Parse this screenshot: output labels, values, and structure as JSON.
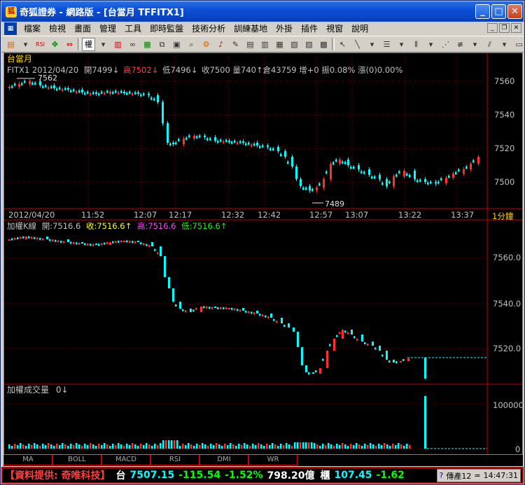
{
  "window": {
    "title": "奇狐證券 - 網路版 - [台當月 TFFITX1]"
  },
  "menu": {
    "items": [
      "檔案",
      "檢視",
      "畫面",
      "管理",
      "工具",
      "即時監盤",
      "技術分析",
      "訓練基地",
      "外掛",
      "插件",
      "視窗",
      "說明"
    ]
  },
  "toolbar": {
    "select_label": "權",
    "rsi_label": "RSI"
  },
  "top_chart": {
    "title": "台當月",
    "info_prefix": "FITX1 2012/04/20",
    "open_label": "開7499↓",
    "high_label": "高7502↓",
    "low_label": "低7496↓",
    "rest": "收7500 量740↑倉43759 增+0 振0.08% 漲(0)0.00%",
    "marker_high": "7562",
    "marker_low": "7489",
    "yticks": [
      "7560",
      "7540",
      "7520",
      "7500"
    ],
    "ytick_values": [
      7560,
      7540,
      7520,
      7500
    ],
    "xticks": [
      "2012/04/20",
      "11:52",
      "12:07",
      "12:17",
      "12:32",
      "12:42",
      "12:57",
      "13:07",
      "13:22",
      "13:37"
    ],
    "period_label": "1分鐘"
  },
  "mid_chart": {
    "title": "加權K線",
    "open_label": "開:7516.6",
    "close_label": "收:7516.6↑",
    "high_label": "高:7516.6",
    "low_label": "低:7516.6↑",
    "yticks": [
      "7560.0",
      "7540.0",
      "7520.0"
    ],
    "ytick_values": [
      7560,
      7540,
      7520
    ]
  },
  "vol_chart": {
    "title": "加權成交量",
    "value_label": "0↓",
    "yticks": [
      "100000",
      "0"
    ]
  },
  "colors": {
    "up": "#ff3030",
    "down": "#00ffff",
    "grid": "#800000",
    "axis": "#c00000"
  },
  "tabs": [
    "MA",
    "BOLL",
    "MACD",
    "RSI",
    "DMI",
    "WR"
  ],
  "status": {
    "provider": "【資料提供: 奇唯科技】",
    "taiex_label": "台",
    "taiex": "7507.15",
    "taiex_chg": "-115.54",
    "taiex_pct": "-1.52%",
    "taiex_amt": "798.20億",
    "otc_label": "櫃",
    "otc": "107.45",
    "otc_chg": "-1.62",
    "channel": "傳產12",
    "eq": "=",
    "time": "14:47:31"
  }
}
